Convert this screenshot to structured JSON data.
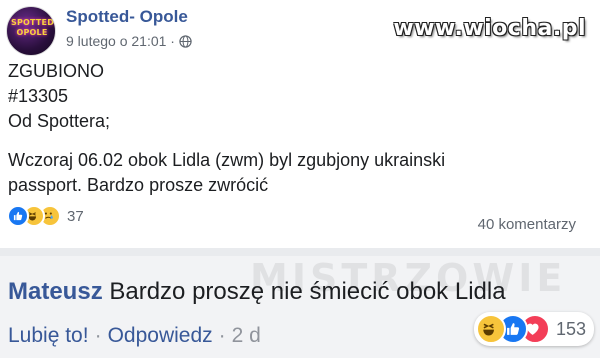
{
  "post": {
    "page_name": "Spotted- Opole",
    "avatar_text": "SPOTTED OPOLE",
    "date": "9 lutego o 21:01 ·",
    "lines": [
      "ZGUBIONO",
      "#13305",
      "Od Spottera;"
    ],
    "body_lines": [
      "Wczoraj 06.02 obok Lidla (zwm) byl zgubjony ukrainski",
      "passport. Bardzo prosze zwrócić"
    ],
    "reaction_count": "37",
    "comments_count": "40 komentarzy",
    "reactions": [
      "like-icon",
      "haha-icon",
      "sad-icon"
    ]
  },
  "watermark": "www.wiocha.pl",
  "watermark2": "MISTRZOWIE",
  "comment": {
    "author": "Mateusz",
    "text": "Bardzo proszę nie śmiecić obok Lidla",
    "like_label": "Lubię to!",
    "reply_label": "Odpowiedz",
    "time": "2 d",
    "reaction_count": "153",
    "reactions": [
      "haha-icon",
      "like-icon",
      "love-icon"
    ]
  },
  "colors": {
    "link": "#385898",
    "like": "#1877f2",
    "haha": "#f7c43b",
    "love": "#f33e58"
  }
}
